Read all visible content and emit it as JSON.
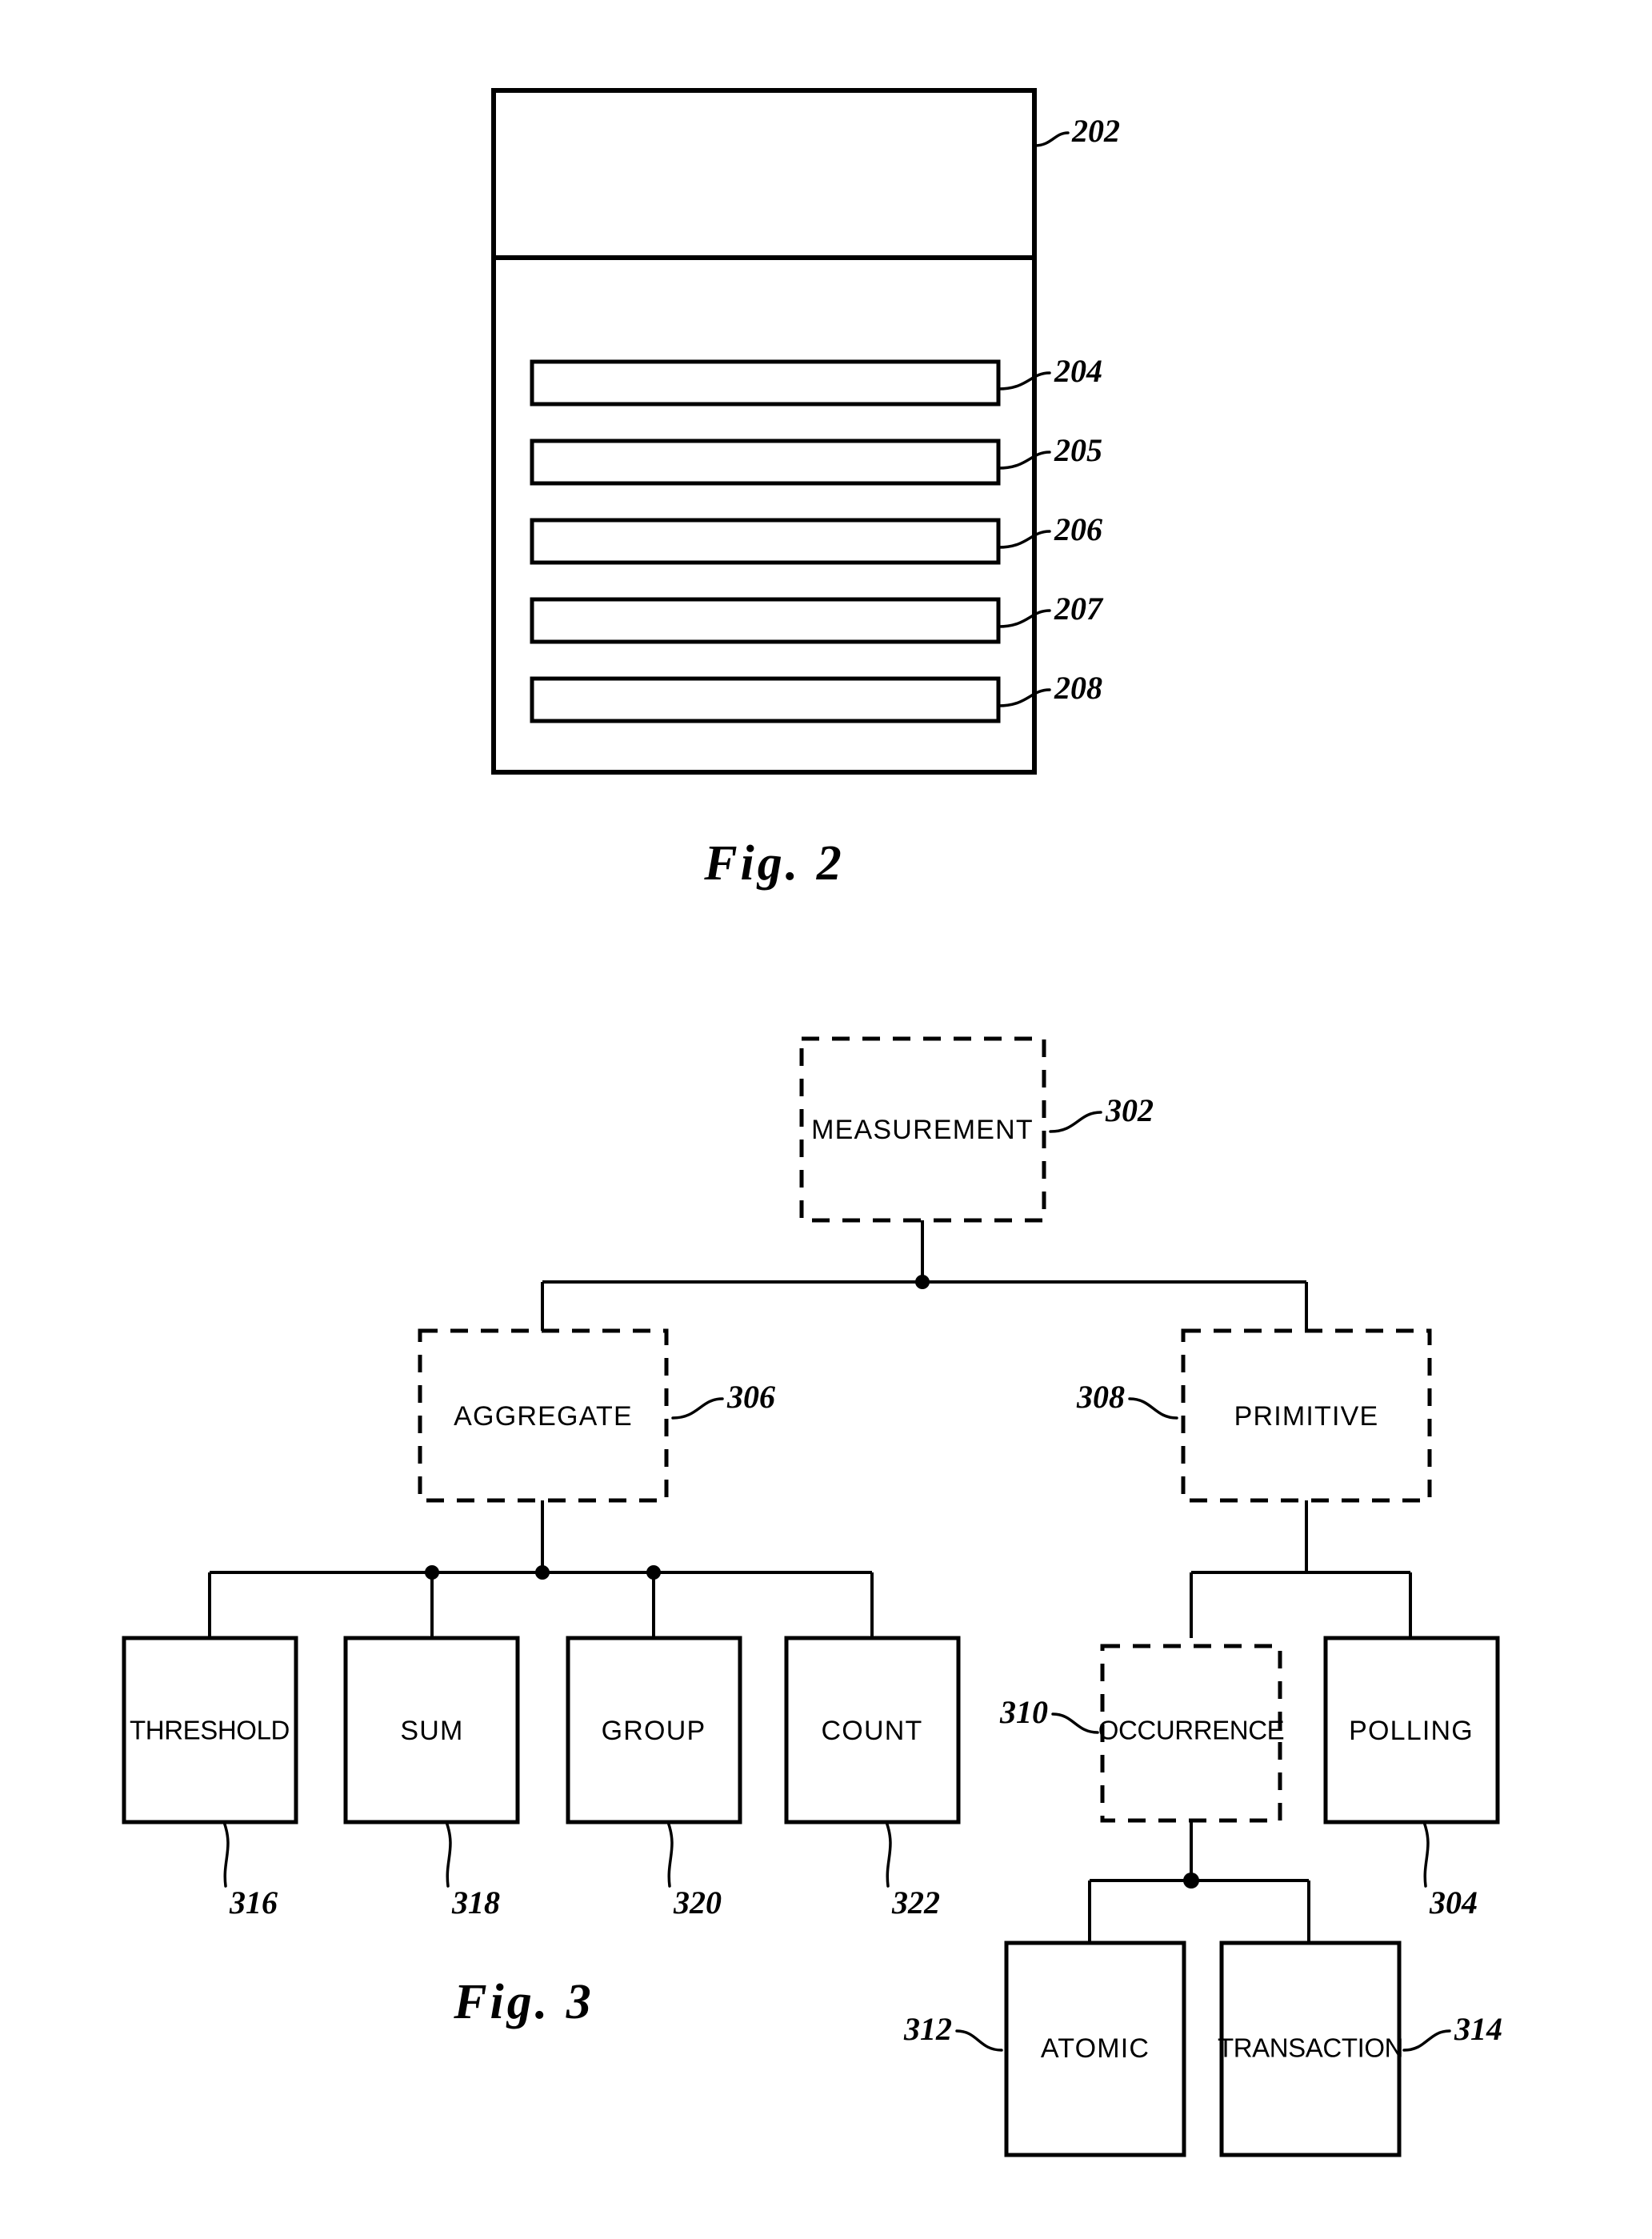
{
  "document": {
    "title": "Patent Drawing Sheet — Figures 2 and 3",
    "background_color": "#ffffff",
    "ink_color": "#000000"
  },
  "figure2": {
    "caption": "Fig. 2",
    "description": "Rectangular container with an upper header region and five horizontal bars",
    "outer_container_ref": "202",
    "bars": [
      {
        "ref": "204"
      },
      {
        "ref": "205"
      },
      {
        "ref": "206"
      },
      {
        "ref": "207"
      },
      {
        "ref": "208"
      }
    ],
    "ref_labels": [
      "202",
      "204",
      "205",
      "206",
      "207",
      "208"
    ]
  },
  "figure3": {
    "caption": "Fig. 3",
    "description": "Hierarchical tree of measurement types",
    "nodes": [
      {
        "id": "measurement",
        "label": "MEASUREMENT",
        "ref": "302",
        "ref_side": "right",
        "border": "dashed"
      },
      {
        "id": "aggregate",
        "label": "AGGREGATE",
        "ref": "306",
        "ref_side": "right",
        "border": "dashed"
      },
      {
        "id": "primitive",
        "label": "PRIMITIVE",
        "ref": "308",
        "ref_side": "left",
        "border": "dashed"
      },
      {
        "id": "threshold",
        "label": "THRESHOLD",
        "ref": "316",
        "ref_side": "below",
        "border": "solid"
      },
      {
        "id": "sum",
        "label": "SUM",
        "ref": "318",
        "ref_side": "below",
        "border": "solid"
      },
      {
        "id": "group",
        "label": "GROUP",
        "ref": "320",
        "ref_side": "below",
        "border": "solid"
      },
      {
        "id": "count",
        "label": "COUNT",
        "ref": "322",
        "ref_side": "below",
        "border": "solid"
      },
      {
        "id": "occurrence",
        "label": "OCCURRENCE",
        "ref": "310",
        "ref_side": "left",
        "border": "dashed"
      },
      {
        "id": "polling",
        "label": "POLLING",
        "ref": "304",
        "ref_side": "below",
        "border": "solid"
      },
      {
        "id": "atomic",
        "label": "ATOMIC",
        "ref": "312",
        "ref_side": "left",
        "border": "solid"
      },
      {
        "id": "transaction",
        "label": "TRANSACTION",
        "ref": "314",
        "ref_side": "right",
        "border": "solid"
      }
    ],
    "edges": [
      {
        "from": "measurement",
        "to": "aggregate"
      },
      {
        "from": "measurement",
        "to": "primitive"
      },
      {
        "from": "aggregate",
        "to": "threshold"
      },
      {
        "from": "aggregate",
        "to": "sum"
      },
      {
        "from": "aggregate",
        "to": "group"
      },
      {
        "from": "aggregate",
        "to": "count"
      },
      {
        "from": "primitive",
        "to": "occurrence"
      },
      {
        "from": "primitive",
        "to": "polling"
      },
      {
        "from": "occurrence",
        "to": "atomic"
      },
      {
        "from": "occurrence",
        "to": "transaction"
      }
    ],
    "ref_labels": [
      "302",
      "304",
      "306",
      "308",
      "310",
      "312",
      "314",
      "316",
      "318",
      "320",
      "322"
    ]
  }
}
